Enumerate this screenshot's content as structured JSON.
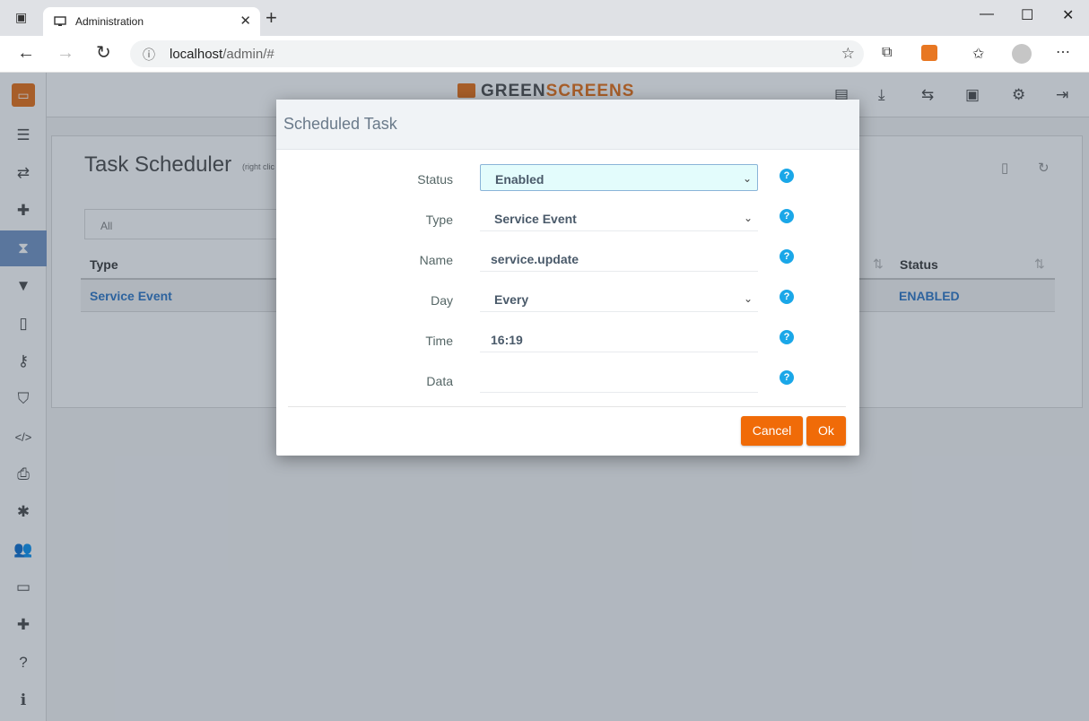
{
  "browser": {
    "tab_title": "Administration",
    "url_host": "localhost",
    "url_path": "/admin/#"
  },
  "app": {
    "brand_part1": "GREEN",
    "brand_part2": "SCREENS",
    "brand_color": "#e87722"
  },
  "page": {
    "title": "Task Scheduler",
    "hint": "(right clic",
    "filter_placeholder": "All",
    "columns": [
      "Type",
      "Status"
    ],
    "rows": [
      {
        "type": "Service Event",
        "status": "ENABLED"
      }
    ]
  },
  "modal": {
    "title": "Scheduled Task",
    "fields": [
      {
        "label": "Status",
        "value": "Enabled"
      },
      {
        "label": "Type",
        "value": "Service Event"
      },
      {
        "label": "Name",
        "value": "service.update"
      },
      {
        "label": "Day",
        "value": "Every"
      },
      {
        "label": "Time",
        "value": "16:19"
      },
      {
        "label": "Data",
        "value": ""
      }
    ],
    "cancel_label": "Cancel",
    "ok_label": "Ok",
    "button_color": "#f06b08",
    "help_color": "#1aa7e8"
  }
}
